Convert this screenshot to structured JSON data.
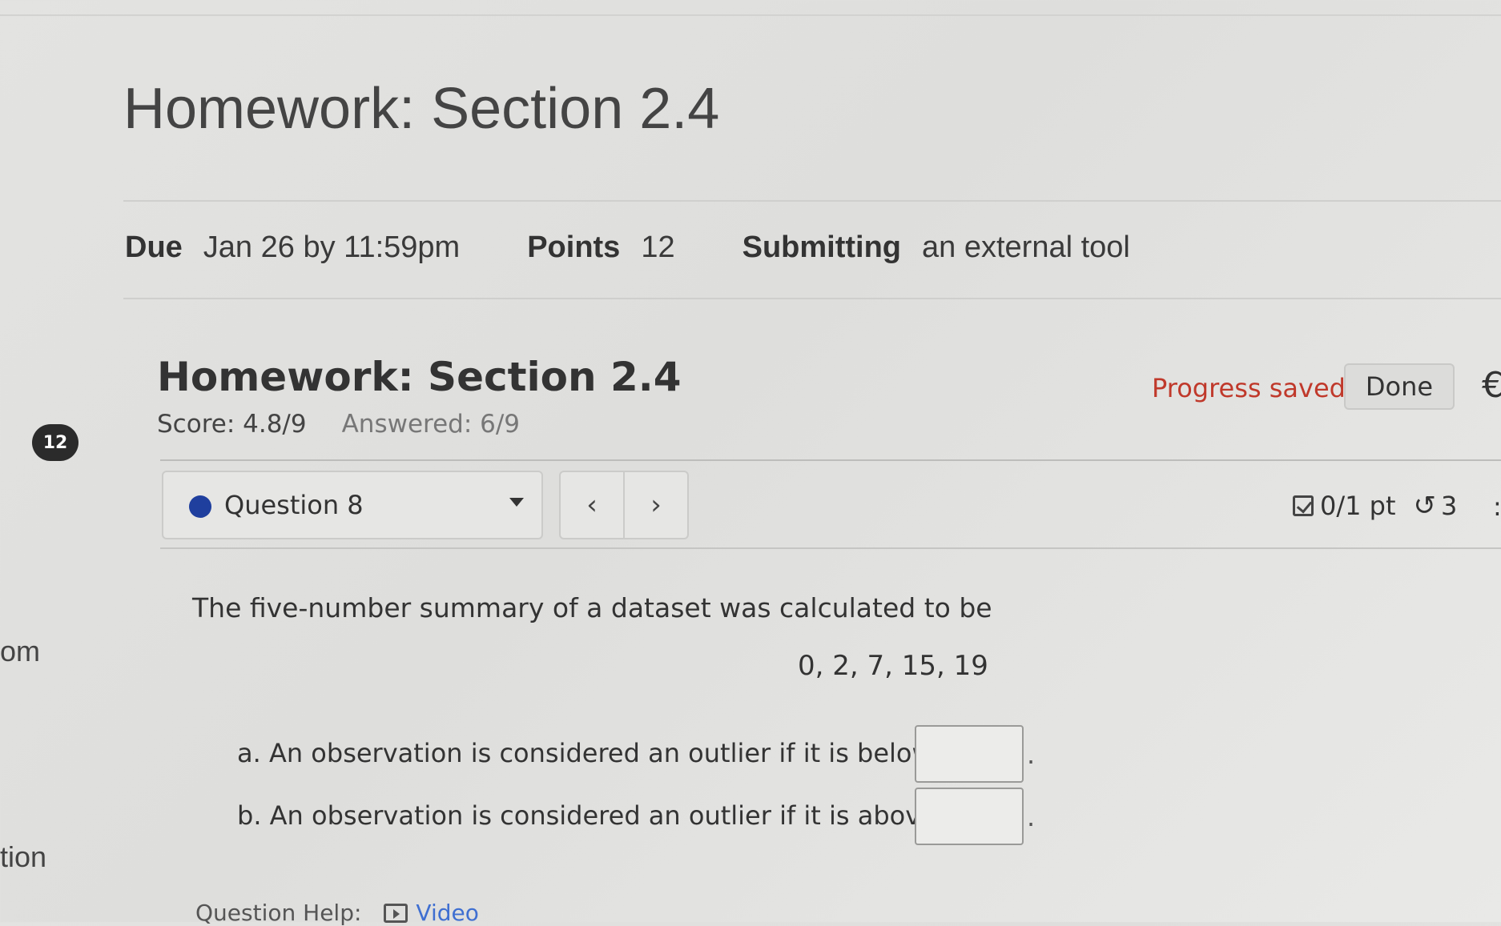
{
  "page": {
    "title": "Homework: Section 2.4"
  },
  "details": {
    "due_label": "Due",
    "due_value": "Jan 26 by 11:59pm",
    "points_label": "Points",
    "points_value": "12",
    "submitting_label": "Submitting",
    "submitting_value": "an external tool"
  },
  "sidebar": {
    "badge_count": "12",
    "fragment_1": "om",
    "fragment_2": "tion"
  },
  "assignment": {
    "title": "Homework: Section 2.4",
    "score": "Score: 4.8/9",
    "answered": "Answered: 6/9",
    "progress_status": "Progress saved",
    "done_label": "Done",
    "progress_color": "#c0392b"
  },
  "question_nav": {
    "selected": "Question 8",
    "prev_glyph": "‹",
    "next_glyph": "›",
    "points": "0/1 pt",
    "attempts": "3",
    "status_dot_color": "#1f3f9e"
  },
  "question": {
    "prompt": "The five-number summary of a dataset was calculated to be",
    "summary": "0, 2, 7, 15, 19",
    "part_a": "a. An observation is considered an outlier if it is below",
    "part_b": "b. An observation is considered an outlier if it is above",
    "answer_a": "",
    "answer_b": "",
    "terminator": "."
  },
  "help": {
    "label": "Question Help:",
    "video_label": "Video",
    "link_color": "#3f6fd1"
  },
  "icons": {
    "points": "checkbox-icon",
    "attempts": "retry-icon",
    "video": "video-icon",
    "dropdown": "chevron-down-icon"
  }
}
